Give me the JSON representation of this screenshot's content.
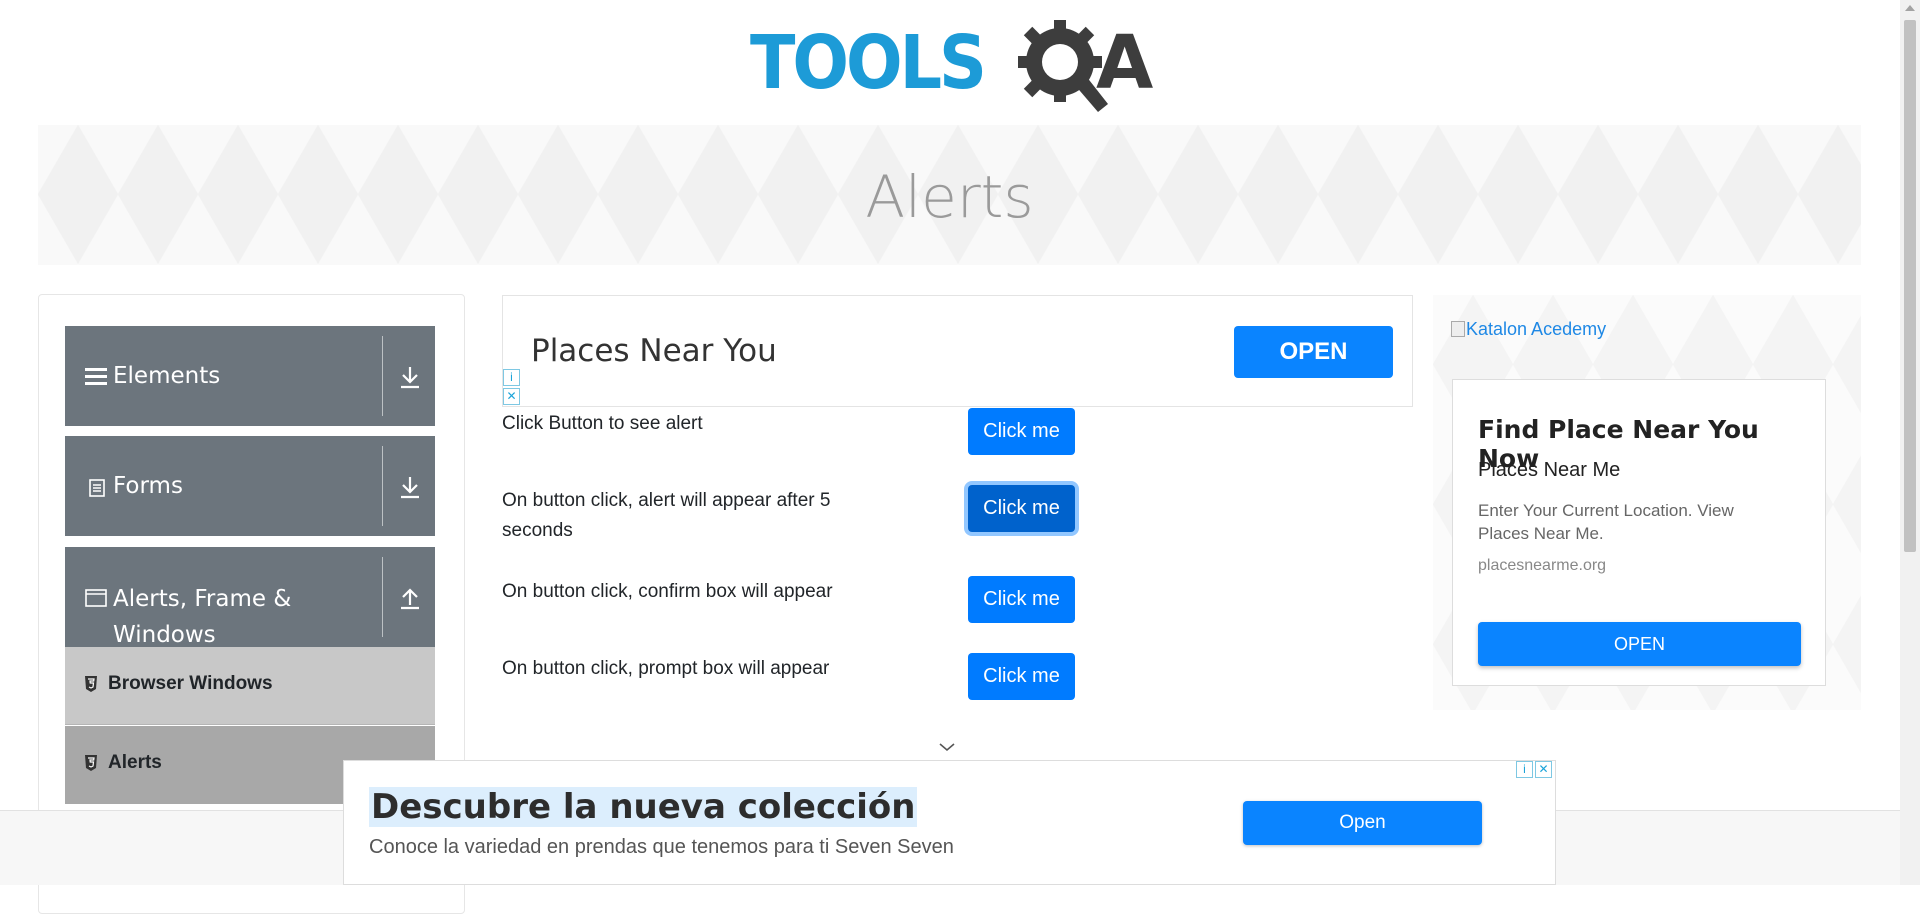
{
  "logo": {
    "tools": "TOOLS",
    "q_icon": "gear-magnifier-icon",
    "a": "A",
    "colors": {
      "tools": "#1d9bd7",
      "qa": "#3d3d3d"
    }
  },
  "page": {
    "title": "Alerts"
  },
  "sidebar": {
    "groups": [
      {
        "label": "Elements",
        "icon": "hamburger-icon",
        "arrow": "download-icon"
      },
      {
        "label": "Forms",
        "icon": "document-icon",
        "arrow": "download-icon"
      },
      {
        "label_line1": "Alerts, Frame &",
        "label_line2": "Windows",
        "icon": "window-icon",
        "arrow": "upload-icon"
      }
    ],
    "items": [
      {
        "label": "Browser Windows",
        "icon": "html5-icon"
      },
      {
        "label": "Alerts",
        "icon": "html5-icon",
        "active": true
      }
    ]
  },
  "top_ad": {
    "title": "Places Near You",
    "button": "OPEN"
  },
  "alerts": [
    {
      "text": "Click Button to see alert",
      "button": "Click me"
    },
    {
      "text": "On button click, alert will appear after 5 seconds",
      "button": "Click me",
      "focused": true
    },
    {
      "text": "On button click, confirm box will appear",
      "button": "Click me"
    },
    {
      "text": "On button click, prompt box will appear",
      "button": "Click me"
    }
  ],
  "right_ad": {
    "image_alt": "Katalon Acedemy",
    "title": "Find Place Near You Now",
    "subtitle": "Places Near Me",
    "description": "Enter Your Current Location. View Places Near Me.",
    "url": "placesnearme.org",
    "button": "OPEN"
  },
  "bottom_ad": {
    "title": "Descubre la nueva colección",
    "description": "Conoce la variedad en prendas que tenemos para ti Seven Seven",
    "button": "Open"
  },
  "colors": {
    "primary": "#007bff",
    "sidebar_group": "#6c757d",
    "sub_item": "#c8c8c8",
    "sub_item_active": "#a8a8a8"
  }
}
